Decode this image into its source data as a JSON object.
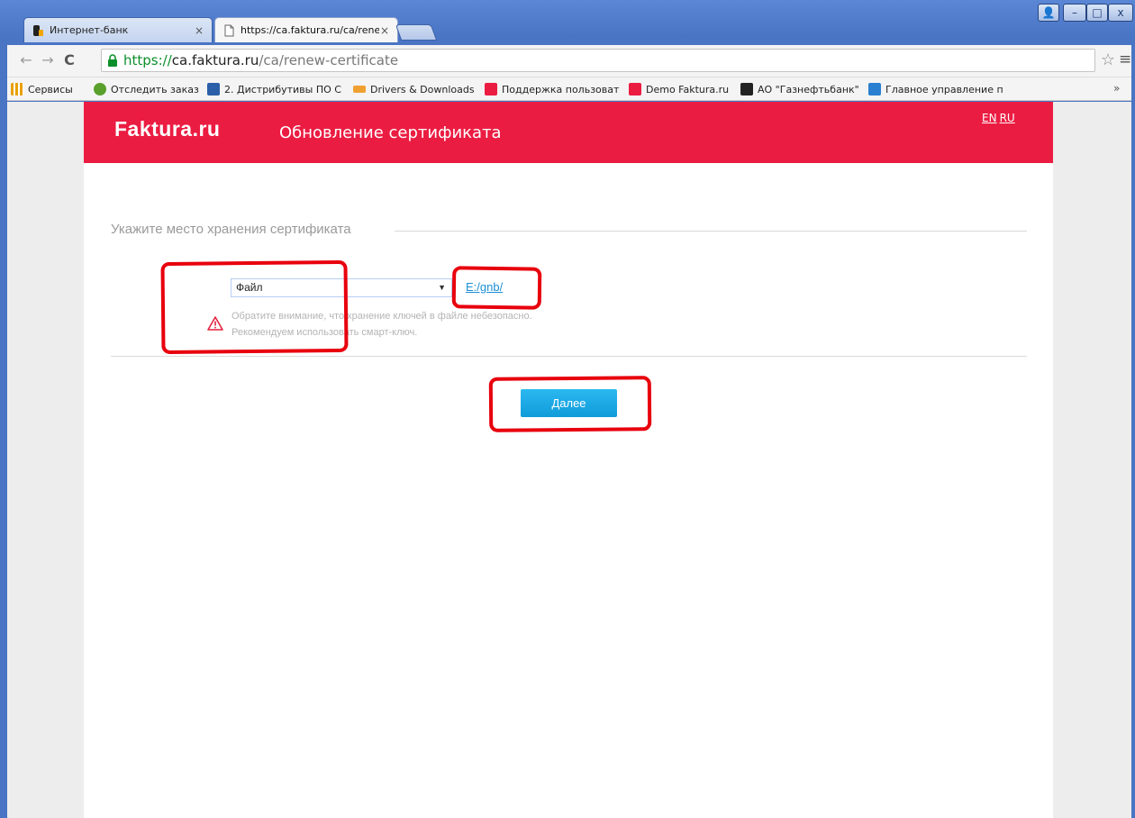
{
  "browser": {
    "tabs": [
      {
        "title": "Интернет-банк",
        "close": "×",
        "active": false
      },
      {
        "title": "https://ca.faktura.ru/ca/rene",
        "close": "×",
        "active": true
      }
    ],
    "window_controls": {
      "user": "👤",
      "minimize": "–",
      "maximize": "□",
      "close": "x"
    },
    "nav": {
      "back": "←",
      "forward": "→",
      "reload": "C"
    },
    "address": {
      "scheme": "https://",
      "host": "ca.faktura.ru",
      "path": "/ca/renew-certificate"
    },
    "star": "☆",
    "menu": "≡",
    "bookmarks": [
      {
        "label": "Сервисы",
        "icon": "apps-grid-icon",
        "color": "#e8a000"
      },
      {
        "label": "Отследить заказ",
        "icon": "tracking-icon",
        "color": "#5aa02c"
      },
      {
        "label": "2. Дистрибутивы ПО С",
        "icon": "tools-icon",
        "color": "#2b5fa8"
      },
      {
        "label": "Drivers & Downloads",
        "icon": "drv-icon",
        "color": "#f0a030"
      },
      {
        "label": "Поддержка пользоват",
        "icon": "faktura-icon",
        "color": "#eb1c42"
      },
      {
        "label": "Demo Faktura.ru",
        "icon": "faktura-icon",
        "color": "#eb1c42"
      },
      {
        "label": "АО \"Газнефтьбанк\"",
        "icon": "bank-icon",
        "color": "#222222"
      },
      {
        "label": "Главное управление п",
        "icon": "emblem-icon",
        "color": "#2a7fd0"
      }
    ],
    "bookmarks_more": "»"
  },
  "page": {
    "logo": "Faktura.ru",
    "title": "Обновление сертификата",
    "lang": {
      "en": "EN",
      "ru": "RU"
    },
    "section_legend": "Укажите место хранения сертификата",
    "storage": {
      "selected": "Файл",
      "arrow": "▼"
    },
    "path_link": "E:/gnb/",
    "warning": {
      "line1": "Обратите внимание, что хранение ключей в файле небезопасно.",
      "line2": "Рекомендуем использовать смарт-ключ."
    },
    "next_button": "Далее"
  },
  "colors": {
    "header_red": "#eb1c42",
    "button_blue": "#109bd9",
    "link_blue": "#1d8fd6",
    "annotation_red": "#e8000d",
    "secure_green": "#0c8f2a"
  }
}
